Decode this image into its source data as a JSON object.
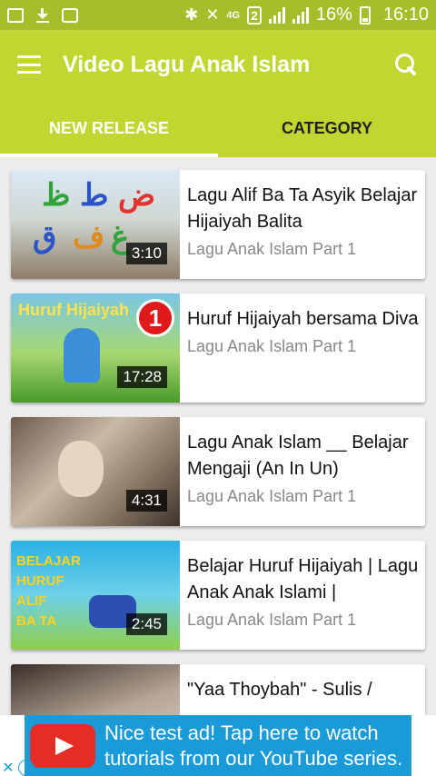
{
  "status_bar": {
    "network": "4G",
    "sim": "2",
    "battery": "16%",
    "time": "16:10"
  },
  "app_bar": {
    "title": "Video Lagu Anak Islam",
    "icons": [
      "menu-icon",
      "search-icon"
    ]
  },
  "tabs": [
    {
      "label": "NEW RELEASE",
      "active": true
    },
    {
      "label": "CATEGORY",
      "active": false
    }
  ],
  "videos": [
    {
      "title": "Lagu Alif Ba Ta Asyik Belajar Hijaiyah Balita",
      "subtitle": "Lagu Anak Islam Part 1",
      "duration": "3:10",
      "thumb_text": [
        "ض",
        "ط",
        "ظ",
        "غ",
        "ف",
        "ق"
      ]
    },
    {
      "title": "Huruf Hijaiyah bersama Diva",
      "subtitle": "Lagu Anak Islam Part 1",
      "duration": "17:28",
      "thumb_text": [
        "Huruf Hijaiyah",
        "1"
      ]
    },
    {
      "title": "Lagu Anak Islam __ Belajar Mengaji (An In Un)",
      "subtitle": "Lagu Anak Islam Part 1",
      "duration": "4:31"
    },
    {
      "title": "Belajar Huruf Hijaiyah | Lagu Anak Anak Islami |",
      "subtitle": "Lagu Anak Islam Part 1",
      "duration": "2:45",
      "thumb_text": [
        "BELAJAR",
        "HURUF",
        "ALIF",
        "BA TA"
      ]
    },
    {
      "title": "\"Yaa Thoybah\" - Sulis /",
      "subtitle": "",
      "duration": ""
    }
  ],
  "ad": {
    "line1": "Nice test ad!  Tap here to watch",
    "line2": "tutorials from our YouTube series.",
    "close_label": "✕",
    "info_label": "i"
  },
  "colors": {
    "status_bar": "#a7bd2a",
    "app_bar": "#c0d631",
    "ad_bg": "#1b9ad8",
    "background": "#ececec"
  }
}
